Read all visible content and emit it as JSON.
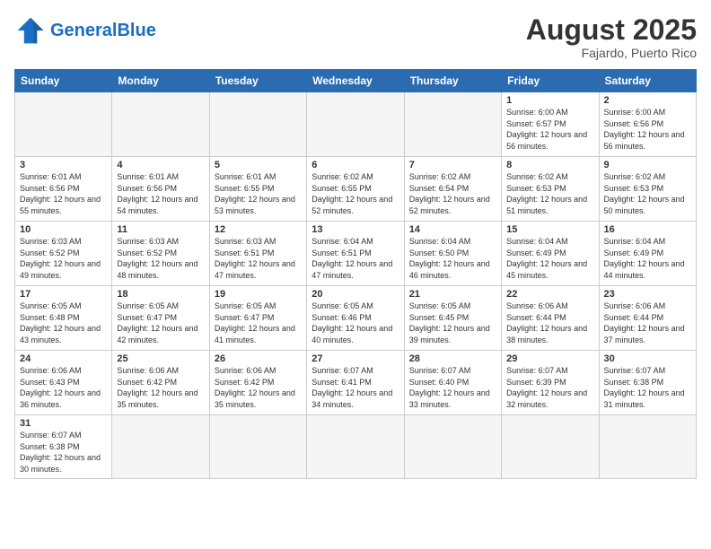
{
  "header": {
    "logo_general": "General",
    "logo_blue": "Blue",
    "month_year": "August 2025",
    "location": "Fajardo, Puerto Rico"
  },
  "days_of_week": [
    "Sunday",
    "Monday",
    "Tuesday",
    "Wednesday",
    "Thursday",
    "Friday",
    "Saturday"
  ],
  "weeks": [
    [
      {
        "day": "",
        "info": ""
      },
      {
        "day": "",
        "info": ""
      },
      {
        "day": "",
        "info": ""
      },
      {
        "day": "",
        "info": ""
      },
      {
        "day": "",
        "info": ""
      },
      {
        "day": "1",
        "info": "Sunrise: 6:00 AM\nSunset: 6:57 PM\nDaylight: 12 hours and 56 minutes."
      },
      {
        "day": "2",
        "info": "Sunrise: 6:00 AM\nSunset: 6:56 PM\nDaylight: 12 hours and 56 minutes."
      }
    ],
    [
      {
        "day": "3",
        "info": "Sunrise: 6:01 AM\nSunset: 6:56 PM\nDaylight: 12 hours and 55 minutes."
      },
      {
        "day": "4",
        "info": "Sunrise: 6:01 AM\nSunset: 6:56 PM\nDaylight: 12 hours and 54 minutes."
      },
      {
        "day": "5",
        "info": "Sunrise: 6:01 AM\nSunset: 6:55 PM\nDaylight: 12 hours and 53 minutes."
      },
      {
        "day": "6",
        "info": "Sunrise: 6:02 AM\nSunset: 6:55 PM\nDaylight: 12 hours and 52 minutes."
      },
      {
        "day": "7",
        "info": "Sunrise: 6:02 AM\nSunset: 6:54 PM\nDaylight: 12 hours and 52 minutes."
      },
      {
        "day": "8",
        "info": "Sunrise: 6:02 AM\nSunset: 6:53 PM\nDaylight: 12 hours and 51 minutes."
      },
      {
        "day": "9",
        "info": "Sunrise: 6:02 AM\nSunset: 6:53 PM\nDaylight: 12 hours and 50 minutes."
      }
    ],
    [
      {
        "day": "10",
        "info": "Sunrise: 6:03 AM\nSunset: 6:52 PM\nDaylight: 12 hours and 49 minutes."
      },
      {
        "day": "11",
        "info": "Sunrise: 6:03 AM\nSunset: 6:52 PM\nDaylight: 12 hours and 48 minutes."
      },
      {
        "day": "12",
        "info": "Sunrise: 6:03 AM\nSunset: 6:51 PM\nDaylight: 12 hours and 47 minutes."
      },
      {
        "day": "13",
        "info": "Sunrise: 6:04 AM\nSunset: 6:51 PM\nDaylight: 12 hours and 47 minutes."
      },
      {
        "day": "14",
        "info": "Sunrise: 6:04 AM\nSunset: 6:50 PM\nDaylight: 12 hours and 46 minutes."
      },
      {
        "day": "15",
        "info": "Sunrise: 6:04 AM\nSunset: 6:49 PM\nDaylight: 12 hours and 45 minutes."
      },
      {
        "day": "16",
        "info": "Sunrise: 6:04 AM\nSunset: 6:49 PM\nDaylight: 12 hours and 44 minutes."
      }
    ],
    [
      {
        "day": "17",
        "info": "Sunrise: 6:05 AM\nSunset: 6:48 PM\nDaylight: 12 hours and 43 minutes."
      },
      {
        "day": "18",
        "info": "Sunrise: 6:05 AM\nSunset: 6:47 PM\nDaylight: 12 hours and 42 minutes."
      },
      {
        "day": "19",
        "info": "Sunrise: 6:05 AM\nSunset: 6:47 PM\nDaylight: 12 hours and 41 minutes."
      },
      {
        "day": "20",
        "info": "Sunrise: 6:05 AM\nSunset: 6:46 PM\nDaylight: 12 hours and 40 minutes."
      },
      {
        "day": "21",
        "info": "Sunrise: 6:05 AM\nSunset: 6:45 PM\nDaylight: 12 hours and 39 minutes."
      },
      {
        "day": "22",
        "info": "Sunrise: 6:06 AM\nSunset: 6:44 PM\nDaylight: 12 hours and 38 minutes."
      },
      {
        "day": "23",
        "info": "Sunrise: 6:06 AM\nSunset: 6:44 PM\nDaylight: 12 hours and 37 minutes."
      }
    ],
    [
      {
        "day": "24",
        "info": "Sunrise: 6:06 AM\nSunset: 6:43 PM\nDaylight: 12 hours and 36 minutes."
      },
      {
        "day": "25",
        "info": "Sunrise: 6:06 AM\nSunset: 6:42 PM\nDaylight: 12 hours and 35 minutes."
      },
      {
        "day": "26",
        "info": "Sunrise: 6:06 AM\nSunset: 6:42 PM\nDaylight: 12 hours and 35 minutes."
      },
      {
        "day": "27",
        "info": "Sunrise: 6:07 AM\nSunset: 6:41 PM\nDaylight: 12 hours and 34 minutes."
      },
      {
        "day": "28",
        "info": "Sunrise: 6:07 AM\nSunset: 6:40 PM\nDaylight: 12 hours and 33 minutes."
      },
      {
        "day": "29",
        "info": "Sunrise: 6:07 AM\nSunset: 6:39 PM\nDaylight: 12 hours and 32 minutes."
      },
      {
        "day": "30",
        "info": "Sunrise: 6:07 AM\nSunset: 6:38 PM\nDaylight: 12 hours and 31 minutes."
      }
    ],
    [
      {
        "day": "31",
        "info": "Sunrise: 6:07 AM\nSunset: 6:38 PM\nDaylight: 12 hours and 30 minutes."
      },
      {
        "day": "",
        "info": ""
      },
      {
        "day": "",
        "info": ""
      },
      {
        "day": "",
        "info": ""
      },
      {
        "day": "",
        "info": ""
      },
      {
        "day": "",
        "info": ""
      },
      {
        "day": "",
        "info": ""
      }
    ]
  ]
}
